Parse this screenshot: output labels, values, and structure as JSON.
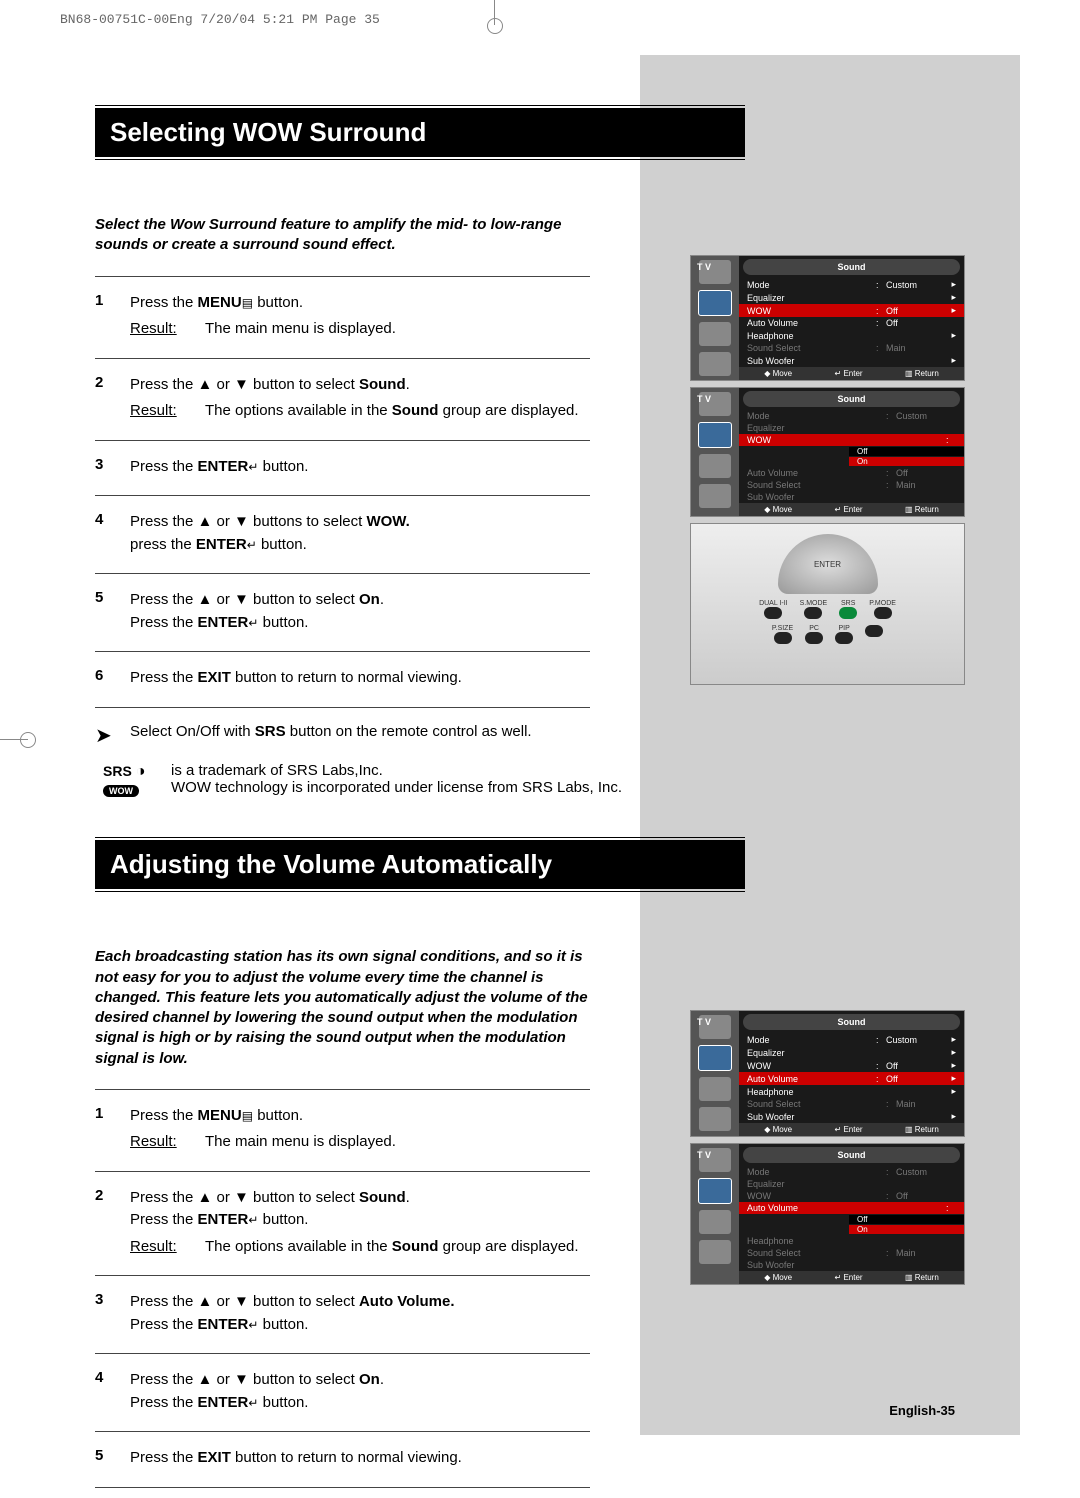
{
  "print_header": "BN68-00751C-00Eng  7/20/04 5:21 PM  Page 35",
  "page_number": "English-35",
  "section1": {
    "title": "Selecting WOW Surround",
    "intro": "Select the Wow Surround feature to amplify the mid- to low-range sounds or create a surround sound effect.",
    "steps": [
      {
        "n": "1",
        "body_pre": "Press the ",
        "b1": "MENU",
        "glyph": "▤",
        "body_post": " button.",
        "result": "The main menu is displayed."
      },
      {
        "n": "2",
        "body_pre": "Press the ▲ or ▼ button to select ",
        "b1": "Sound",
        "body_post": ".",
        "result_html": "The options available in the <b>Sound</b> group are displayed."
      },
      {
        "n": "3",
        "body_pre": "Press the  ",
        "b1": "ENTER",
        "glyph": "↵",
        "body_post": "  button."
      },
      {
        "n": "4",
        "line1_pre": "Press the ▲ or ▼ buttons to select ",
        "line1_b": "WOW.",
        "line2_pre": "press the  ",
        "line2_b": "ENTER",
        "line2_glyph": "↵",
        "line2_post": "  button."
      },
      {
        "n": "5",
        "line1_pre": "Press the ▲ or ▼ button to select ",
        "line1_b": "On",
        "line1_post": ".",
        "line2_pre": "Press the ",
        "line2_b": "ENTER",
        "line2_glyph": "↵",
        "line2_post": " button."
      },
      {
        "n": "6",
        "body_pre": "Press the ",
        "b1": "EXIT",
        "body_post": " button to return to normal viewing."
      }
    ],
    "note": "Select On/Off with <b>SRS</b> button on the remote control as well.",
    "srs_label": "SRS",
    "srs_sub": "WOW",
    "srs_text": "is a trademark of SRS Labs,Inc.\nWOW technology is incorporated under license from SRS Labs, Inc."
  },
  "section2": {
    "title": "Adjusting the Volume Automatically",
    "intro": "Each broadcasting station has its own signal conditions, and so it is not easy for you to adjust the volume every time the channel is changed. This feature lets you automatically adjust the volume of the desired channel by lowering the sound output when the modulation signal is high or by raising the sound output when the modulation signal is low.",
    "steps": [
      {
        "n": "1",
        "body_pre": "Press the ",
        "b1": "MENU",
        "glyph": "▤",
        "body_post": " button.",
        "result": "The main menu is displayed."
      },
      {
        "n": "2",
        "line1_pre": "Press the ▲ or ▼ button to select ",
        "line1_b": "Sound",
        "line1_post": ".",
        "line2_pre": "Press the ",
        "line2_b": "ENTER",
        "line2_glyph": "↵",
        "line2_post": " button.",
        "result_html": "The options available in the <b>Sound</b> group are displayed."
      },
      {
        "n": "3",
        "line1_pre": "Press the ▲ or ▼ button to select ",
        "line1_b": "Auto Volume.",
        "line2_pre": "Press the ",
        "line2_b": "ENTER",
        "line2_glyph": "↵",
        "line2_post": " button."
      },
      {
        "n": "4",
        "line1_pre": "Press the ▲ or ▼  button to select ",
        "line1_b": "On",
        "line1_post": ".",
        "line2_pre": "Press the ",
        "line2_b": "ENTER",
        "line2_glyph": "↵",
        "line2_post": " button."
      },
      {
        "n": "5",
        "body_pre": "Press the ",
        "b1": "EXIT",
        "body_post": " button to return to normal viewing."
      }
    ]
  },
  "osd": {
    "tv": "T V",
    "title": "Sound",
    "rows": {
      "mode": "Mode",
      "mode_v": "Custom",
      "eq": "Equalizer",
      "wow": "WOW",
      "wow_v": "Off",
      "av": "Auto Volume",
      "av_v": "Off",
      "hp": "Headphone",
      "ss": "Sound Select",
      "ss_v": "Main",
      "sw": "Sub Woofer"
    },
    "opts": {
      "off": "Off",
      "on": "On"
    },
    "footer": {
      "move": "Move",
      "enter": "Enter",
      "return": "Return"
    }
  },
  "remote": {
    "enter": "ENTER",
    "labels": [
      "DUAL I-II",
      "S.MODE",
      "SRS",
      "P.MODE"
    ],
    "labels2": [
      "P.SIZE",
      "PC",
      "PIP",
      ""
    ]
  }
}
